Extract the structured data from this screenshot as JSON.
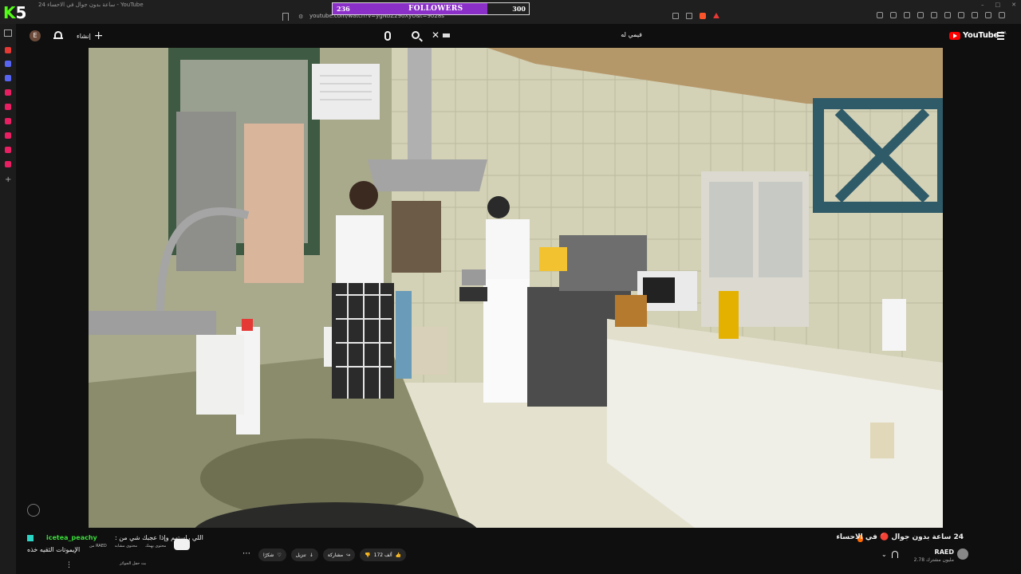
{
  "browser": {
    "tab_title": "24 ساعة بدون جوال في الاحساء - YouTube",
    "url": "youtube.com/watch?v=ygNbZ29oXyU&t=9028s",
    "logo_k": "K",
    "logo_5": "5"
  },
  "followers_overlay": {
    "current": "236",
    "label": "FOLLOWERS",
    "goal": "300",
    "progress": 0.79,
    "fill_color": "#8b2fc9"
  },
  "yt_header": {
    "avatar_letter": "E",
    "create_label": "إنشاء",
    "search_query": "فيمي له",
    "logo_text": "YouTube",
    "country_code": "SA"
  },
  "video": {
    "title": "24 ساعة بدون جوال 🔴 في الاحساء",
    "channel_name": "RAED",
    "subscribers": "2.78 مليون مشترك"
  },
  "actions": {
    "like_count": "172 ألف",
    "share_label": "مشاركة",
    "download_label": "تنزيل",
    "thanks_label": "شكرًا",
    "more": "⋯"
  },
  "chat": {
    "username": "icetea_peachy",
    "message_line1": "اللي راستهم وإذا عجبك شي من :",
    "message_line2": "الإيموتات الثقيه خذه"
  },
  "sub_tabs": [
    "من RAED",
    "محتوى مشابه",
    "محتوى يهمك"
  ],
  "related_label": "بث حفل الجوائز"
}
